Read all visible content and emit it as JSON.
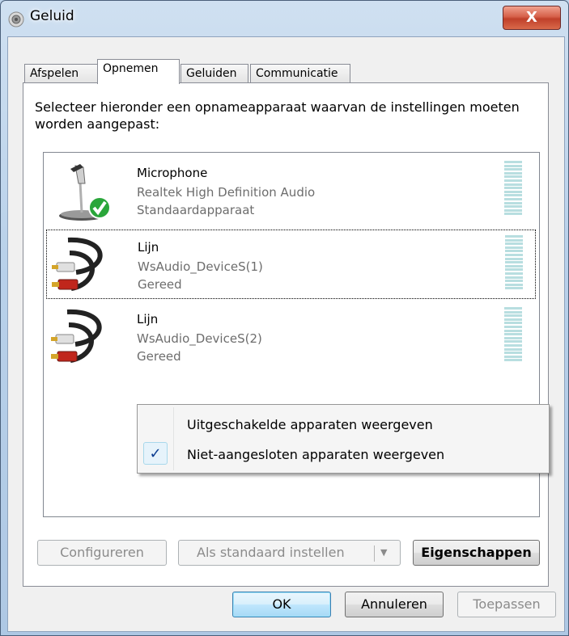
{
  "window": {
    "title": "Geluid",
    "close_label": "X"
  },
  "tabs": [
    {
      "label": "Afspelen"
    },
    {
      "label": "Opnemen"
    },
    {
      "label": "Geluiden"
    },
    {
      "label": "Communicatie"
    }
  ],
  "instructions": "Selecteer hieronder een opnameapparaat waarvan de instellingen moeten worden aangepast:",
  "devices": [
    {
      "name": "Microphone",
      "driver": "Realtek High Definition Audio",
      "status": "Standaardapparaat",
      "icon": "microphone-icon"
    },
    {
      "name": "Lijn",
      "driver": "WsAudio_DeviceS(1)",
      "status": "Gereed",
      "icon": "rca-cable-icon"
    },
    {
      "name": "Lijn",
      "driver": "WsAudio_DeviceS(2)",
      "status": "Gereed",
      "icon": "rca-cable-icon"
    }
  ],
  "context_menu": {
    "items": [
      {
        "label": "Uitgeschakelde apparaten weergeven",
        "checked": false
      },
      {
        "label": "Niet-aangesloten apparaten weergeven",
        "checked": true
      }
    ],
    "check_glyph": "✓"
  },
  "panel_buttons": {
    "configure": "Configureren",
    "set_default": "Als standaard instellen",
    "properties": "Eigenschappen"
  },
  "dialog_buttons": {
    "ok": "OK",
    "cancel": "Annuleren",
    "apply": "Toepassen"
  },
  "colors": {
    "meter": "#b8dee0",
    "accent": "#3c7fb1",
    "check": "#19a02a"
  }
}
